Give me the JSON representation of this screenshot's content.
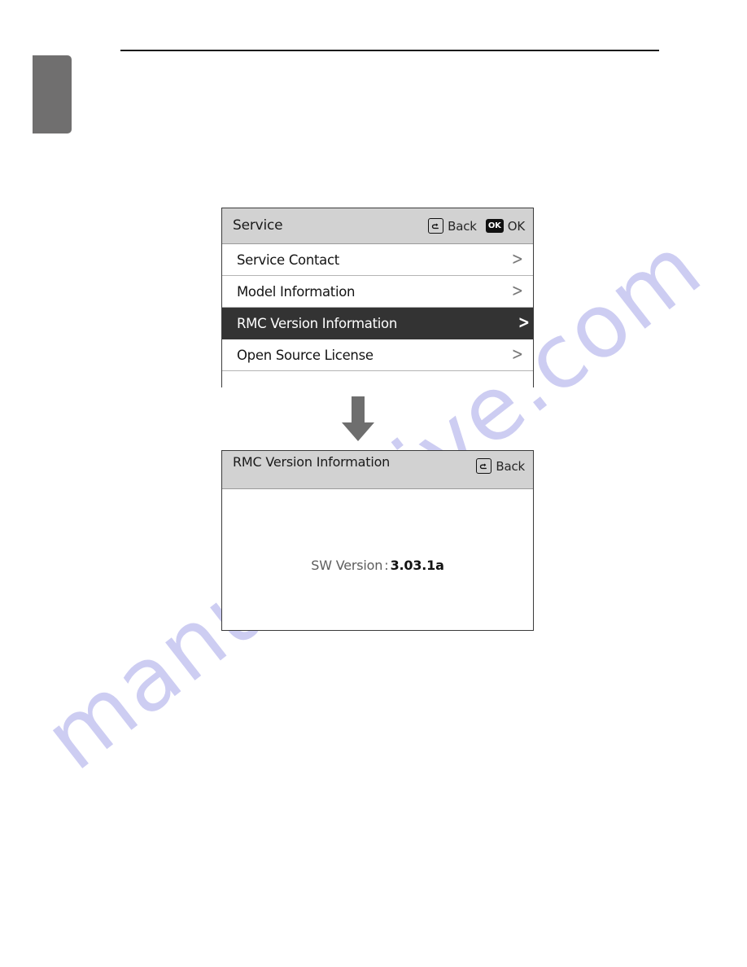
{
  "page": {
    "watermark_text": "manualshive.com",
    "watermark_color": "#cdcdf2",
    "tab_color": "#706f6f"
  },
  "flow": {
    "arrow_icon": "down-arrow-icon",
    "arrow_color": "#6e6e6e"
  },
  "service_screen": {
    "title": "Service",
    "actions": [
      {
        "icon": "back-icon",
        "label": "Back"
      },
      {
        "icon": "ok-icon",
        "label": "OK"
      }
    ],
    "ok_key_text": "OK",
    "items": [
      {
        "label": "Service Contact",
        "chevron": ">",
        "selected": false
      },
      {
        "label": "Model Information",
        "chevron": ">",
        "selected": false
      },
      {
        "label": "RMC Version Information",
        "chevron": ">",
        "selected": true
      },
      {
        "label": "Open Source License",
        "chevron": ">",
        "selected": false
      }
    ],
    "selected_row_bg": "#333333",
    "header_bg": "#d2d2d2"
  },
  "version_screen": {
    "title": "RMC Version Information",
    "back": {
      "icon": "back-icon",
      "label": "Back"
    },
    "sw_label": "SW Version",
    "separator": ":",
    "sw_value": "3.03.1a"
  }
}
